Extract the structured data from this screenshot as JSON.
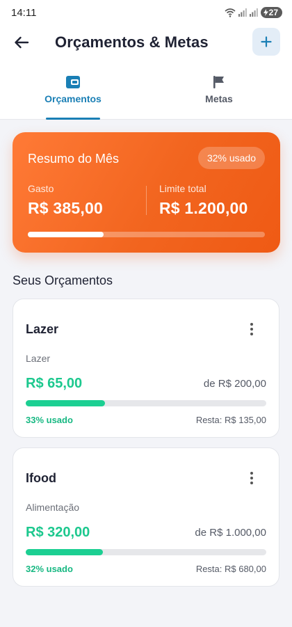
{
  "status_bar": {
    "time": "14:11",
    "battery": "27"
  },
  "header": {
    "title": "Orçamentos & Metas",
    "back_icon": "arrow-left-icon",
    "add_icon": "plus-icon"
  },
  "tabs": [
    {
      "label": "Orçamentos",
      "icon": "wallet-icon",
      "active": true
    },
    {
      "label": "Metas",
      "icon": "flag-icon",
      "active": false
    }
  ],
  "summary": {
    "title": "Resumo do Mês",
    "usage_badge": "32% usado",
    "spent_label": "Gasto",
    "spent_value": "R$ 385,00",
    "limit_label": "Limite total",
    "limit_value": "R$ 1.200,00",
    "progress": 0.32
  },
  "section_title": "Seus Orçamentos",
  "budgets": [
    {
      "name": "Lazer",
      "category": "Lazer",
      "spent": "R$ 65,00",
      "limit": "de R$ 200,00",
      "progress": 0.33,
      "used": "33% usado",
      "remaining": "Resta: R$ 135,00"
    },
    {
      "name": "Ifood",
      "category": "Alimentação",
      "spent": "R$ 320,00",
      "limit": "de R$ 1.000,00",
      "progress": 0.32,
      "used": "32% usado",
      "remaining": "Resta: R$ 680,00"
    }
  ],
  "colors": {
    "accent": "#1a7fb5",
    "summary_gradient_start": "#ff7a36",
    "summary_gradient_end": "#ef5a14",
    "progress_green": "#1ccf92"
  }
}
